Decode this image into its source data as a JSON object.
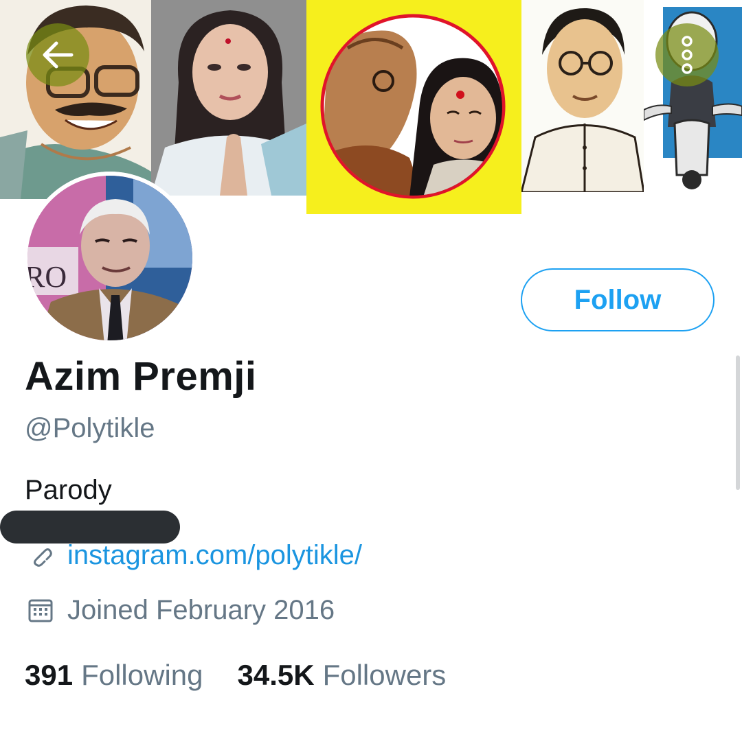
{
  "banner": {
    "back_icon": "arrow-left-icon",
    "more_icon": "more-vertical-icon",
    "accent_color": "#7f8c14"
  },
  "profile": {
    "display_name": "Azim Premji",
    "handle": "@Polytikle",
    "bio": "Parody",
    "link": "instagram.com/polytikle/",
    "joined": "Joined February 2016",
    "link_icon": "link-icon",
    "calendar_icon": "calendar-icon"
  },
  "actions": {
    "follow_label": "Follow",
    "accent_color": "#1da1f2"
  },
  "stats": {
    "following_count": "391",
    "following_label": "Following",
    "followers_count": "34.5K",
    "followers_label": "Followers"
  }
}
